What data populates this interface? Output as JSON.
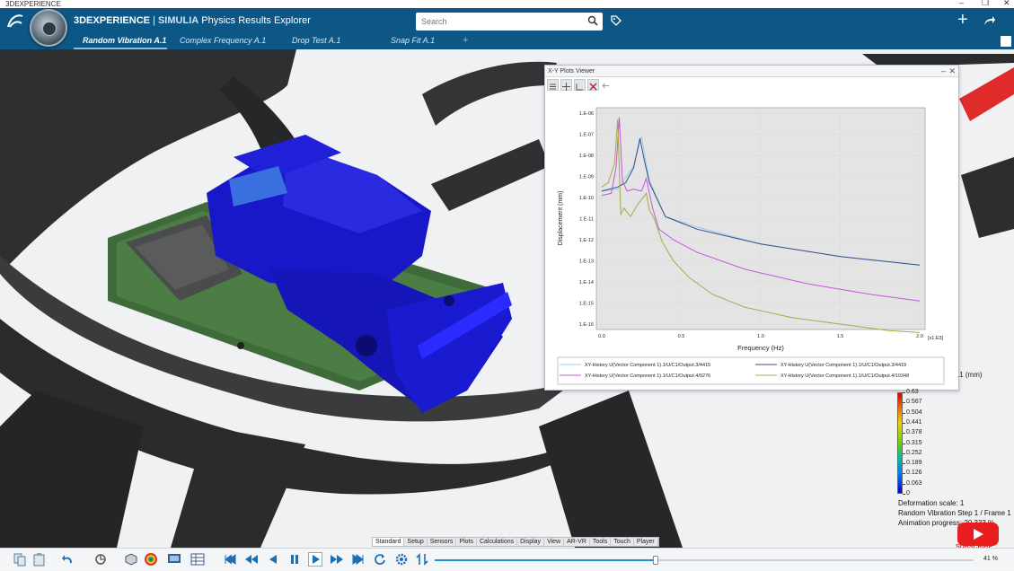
{
  "os": {
    "title": "3DEXPERIENCE"
  },
  "header": {
    "brand_bold": "3DEXPERIENCE",
    "brand_sep": " | ",
    "brand_app": "SIMULIA",
    "brand_rest": " Physics Results Explorer",
    "search_placeholder": "Search"
  },
  "tabs": [
    {
      "label": "Random Vibration A.1",
      "active": true
    },
    {
      "label": "Complex Frequency A.1",
      "active": false
    },
    {
      "label": "Drop Test A.1",
      "active": false
    },
    {
      "label": "Snap Fit A.1",
      "active": false
    }
  ],
  "plot_window": {
    "title": "X-Y Plots Viewer"
  },
  "chart_data": {
    "type": "line",
    "xlabel": "Frequency (Hz)",
    "ylabel": "Displacement (mm)",
    "x_multiplier": "[x1.E3]",
    "x_ticks": [
      "0.0",
      "0.5",
      "1.0",
      "1.5",
      "2.0"
    ],
    "y_ticks": [
      "1.E-06",
      "1.E-07",
      "1.E-08",
      "1.E-09",
      "1.E-10",
      "1.E-11",
      "1.E-12",
      "1.E-13",
      "1.E-14",
      "1.E-15",
      "1.E-16"
    ],
    "xlim": [
      0,
      2.0
    ],
    "ylog_exp_range": [
      -6,
      -16
    ],
    "series": [
      {
        "name": "XY-History U(Vector Component 1).1/U/C1/Output.3/4415",
        "color": "#8fd3ee",
        "x": [
          0.0,
          0.1,
          0.2,
          0.25,
          0.3,
          0.4,
          0.6,
          1.0,
          1.5,
          2.0
        ],
        "exp": [
          -9.7,
          -9.6,
          -8.5,
          -7.1,
          -9.2,
          -10.9,
          -11.4,
          -12.2,
          -12.8,
          -13.2
        ]
      },
      {
        "name": "XY-History U(Vector Component 1).1/U/C1/Output.3/4419",
        "color": "#3a4a8a",
        "x": [
          0.0,
          0.1,
          0.15,
          0.2,
          0.24,
          0.27,
          0.3,
          0.4,
          0.6,
          1.0,
          1.5,
          2.0
        ],
        "exp": [
          -9.7,
          -9.5,
          -9.3,
          -8.6,
          -7.2,
          -8.3,
          -9.3,
          -10.9,
          -11.5,
          -12.2,
          -12.8,
          -13.2
        ]
      },
      {
        "name": "XY-History U(Vector Component 1).1/U/C1/Output.4/9276",
        "color": "#c456d8",
        "x": [
          0.0,
          0.06,
          0.09,
          0.11,
          0.13,
          0.16,
          0.2,
          0.25,
          0.28,
          0.32,
          0.36,
          0.45,
          0.6,
          0.9,
          1.3,
          1.7,
          2.0
        ],
        "exp": [
          -9.9,
          -9.8,
          -8.6,
          -6.2,
          -9.2,
          -9.7,
          -9.6,
          -9.7,
          -9.1,
          -10.5,
          -11.5,
          -12.0,
          -12.6,
          -13.4,
          -14.1,
          -14.6,
          -14.9
        ]
      },
      {
        "name": "XY-History U(Vector Component 1).1/U/C1/Output.4/10348",
        "color": "#a6a84a",
        "x": [
          0.0,
          0.04,
          0.08,
          0.1,
          0.12,
          0.14,
          0.18,
          0.22,
          0.25,
          0.28,
          0.3,
          0.33,
          0.38,
          0.45,
          0.55,
          0.7,
          0.9,
          1.2,
          1.5,
          1.8,
          2.0
        ],
        "exp": [
          -9.5,
          -9.3,
          -8.4,
          -6.3,
          -10.8,
          -10.5,
          -10.9,
          -10.4,
          -10.1,
          -9.8,
          -10.6,
          -11.0,
          -12.1,
          -13.0,
          -13.8,
          -14.6,
          -15.2,
          -15.7,
          -16.0,
          -16.3,
          -16.4
        ]
      }
    ]
  },
  "colorbar": {
    "unit": ".1 (mm)",
    "labels": [
      "0.63",
      "0.567",
      "0.504",
      "0.441",
      "0.378",
      "0.315",
      "0.252",
      "0.189",
      "0.126",
      "0.063",
      "0"
    ]
  },
  "info": {
    "deformation": "Deformation scale: 1",
    "step": "Random Vibration Step 1 / Frame 1",
    "animation": "Animation progress: 20.333 %"
  },
  "subscribe": "SUBSCRIBE",
  "cmd_tabs": [
    "Standard",
    "Setup",
    "Sensors",
    "Plots",
    "Calculations",
    "Display",
    "View",
    "AR-VR",
    "Tools",
    "Touch",
    "Player"
  ],
  "active_cmd_tab": "Standard",
  "player": {
    "zoom": "41 %",
    "progress": 0.41
  }
}
